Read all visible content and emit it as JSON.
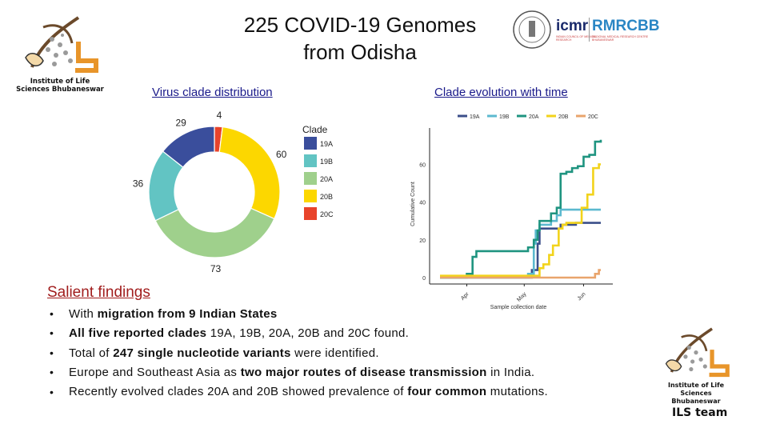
{
  "slide": {
    "title_line1": "225 COVID-19 Genomes",
    "title_line2": "from Odisha",
    "link_left": "Virus clade distribution",
    "link_right": "Clade evolution with time",
    "salient_heading": "Salient findings",
    "bullet_char": "•",
    "bullets": [
      {
        "a": "With ",
        "b": "migration from 9 Indian States",
        "c": ""
      },
      {
        "a": "",
        "b": "All five reported clades ",
        "c": "19A, 19B, 20A, 20B and 20C found."
      },
      {
        "a": "Total of ",
        "b": "247 single nucleotide variants",
        "c": " were identified."
      },
      {
        "a": "Europe and Southeast Asia as ",
        "b": "two major routes of disease transmission",
        "c": " in India."
      },
      {
        "a": "Recently evolved clades 20A and 20B showed prevalence of ",
        "b": "four common",
        "c": " mutations."
      }
    ],
    "footer_team": "ILS team"
  },
  "logos": {
    "ils_line1": "Institute of Life",
    "ils_line2": "Sciences Bhubaneswar",
    "icmr": "icmr",
    "icmr_sub": "INDIAN COUNCIL OF MEDICAL RESEARCH",
    "rmrcbb": "RMRCBB",
    "rmrcbb_sub": "REGIONAL MEDICAL RESEARCH CENTRE BHUBANESWAR"
  },
  "chart_data": [
    {
      "type": "pie",
      "donut": true,
      "legend_title": "Clade",
      "legend_position": "right",
      "categories": [
        "19A",
        "19B",
        "20A",
        "20B",
        "20C"
      ],
      "values": [
        29,
        36,
        73,
        60,
        4
      ],
      "colors": [
        "#3a4e9c",
        "#62c4c3",
        "#9fd08c",
        "#fcd700",
        "#e8432a"
      ]
    },
    {
      "type": "line",
      "step": true,
      "xlabel": "Sample collection date",
      "ylabel": "Cumulative Count",
      "x_ticks": [
        "Apr",
        "May",
        "Jun"
      ],
      "y_ticks": [
        0,
        20,
        40,
        60
      ],
      "ylim": [
        0,
        75
      ],
      "xlim": [
        "2020-03-18",
        "2020-06-10"
      ],
      "legend_position": "top",
      "grid": false,
      "series": [
        {
          "name": "19A",
          "color": "#3b4f8a",
          "points": [
            [
              "2020-03-18",
              0
            ],
            [
              "2020-05-05",
              4
            ],
            [
              "2020-05-08",
              18
            ],
            [
              "2020-05-09",
              26
            ],
            [
              "2020-05-20",
              28
            ],
            [
              "2020-05-28",
              29
            ],
            [
              "2020-06-10",
              29
            ]
          ]
        },
        {
          "name": "19B",
          "color": "#5cb9cf",
          "points": [
            [
              "2020-03-18",
              0
            ],
            [
              "2020-05-03",
              2
            ],
            [
              "2020-05-06",
              18
            ],
            [
              "2020-05-07",
              25
            ],
            [
              "2020-05-09",
              28
            ],
            [
              "2020-05-15",
              30
            ],
            [
              "2020-05-18",
              33
            ],
            [
              "2020-05-20",
              36
            ],
            [
              "2020-06-10",
              36
            ]
          ]
        },
        {
          "name": "20A",
          "color": "#1f9480",
          "points": [
            [
              "2020-03-18",
              0
            ],
            [
              "2020-04-01",
              2
            ],
            [
              "2020-04-04",
              11
            ],
            [
              "2020-04-06",
              14
            ],
            [
              "2020-05-03",
              16
            ],
            [
              "2020-05-06",
              20
            ],
            [
              "2020-05-08",
              25
            ],
            [
              "2020-05-09",
              30
            ],
            [
              "2020-05-15",
              34
            ],
            [
              "2020-05-18",
              37
            ],
            [
              "2020-05-20",
              55
            ],
            [
              "2020-05-23",
              56
            ],
            [
              "2020-05-26",
              58
            ],
            [
              "2020-05-29",
              59
            ],
            [
              "2020-06-01",
              64
            ],
            [
              "2020-06-04",
              65
            ],
            [
              "2020-06-07",
              72
            ],
            [
              "2020-06-10",
              73
            ]
          ]
        },
        {
          "name": "20B",
          "color": "#f2d31b",
          "points": [
            [
              "2020-03-18",
              1
            ],
            [
              "2020-05-09",
              5
            ],
            [
              "2020-05-11",
              7
            ],
            [
              "2020-05-14",
              12
            ],
            [
              "2020-05-16",
              17
            ],
            [
              "2020-05-19",
              26
            ],
            [
              "2020-05-21",
              28
            ],
            [
              "2020-05-23",
              29
            ],
            [
              "2020-05-31",
              37
            ],
            [
              "2020-06-03",
              44
            ],
            [
              "2020-06-06",
              58
            ],
            [
              "2020-06-09",
              60
            ],
            [
              "2020-06-10",
              60
            ]
          ]
        },
        {
          "name": "20C",
          "color": "#e9a46c",
          "points": [
            [
              "2020-03-18",
              0
            ],
            [
              "2020-06-07",
              2
            ],
            [
              "2020-06-09",
              4
            ],
            [
              "2020-06-10",
              4
            ]
          ]
        }
      ]
    }
  ]
}
